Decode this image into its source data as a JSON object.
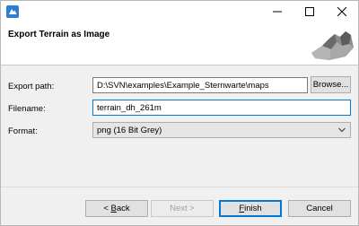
{
  "window": {
    "title_buttons": {
      "minimize": "minimize",
      "maximize": "maximize",
      "close": "close"
    }
  },
  "header": {
    "title": "Export Terrain as Image"
  },
  "form": {
    "export_path_label": "Export path:",
    "export_path_value": "D:\\SVN\\examples\\Example_Sternwarte\\maps",
    "browse_label": "Browse...",
    "filename_label": "Filename:",
    "filename_value": "terrain_dh_261m",
    "format_label": "Format:",
    "format_value": "png (16 Bit Grey)"
  },
  "footer": {
    "back_label_prefix": "< ",
    "back_label_accel": "B",
    "back_label_rest": "ack",
    "next_label": "Next >",
    "finish_label_accel": "F",
    "finish_label_rest": "inish",
    "cancel_label": "Cancel"
  },
  "icons": {
    "app": "app-icon",
    "terrain": "terrain-preview-icon",
    "dropdown": "chevron-down-icon"
  },
  "colors": {
    "accent": "#0078d7",
    "app_icon": "#2f7fd0"
  }
}
